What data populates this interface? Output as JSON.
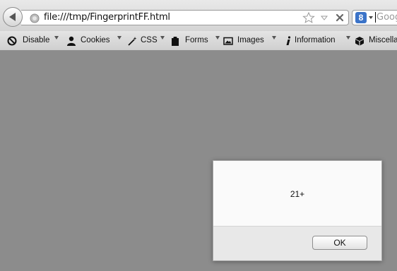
{
  "browser": {
    "url": "file:///tmp/FingerprintFF.html",
    "search_placeholder": "Goog",
    "search_engine_glyph": "8"
  },
  "toolbar": {
    "items": [
      {
        "label": "Disable",
        "icon": "no-entry-icon"
      },
      {
        "label": "Cookies",
        "icon": "person-icon"
      },
      {
        "label": "CSS",
        "icon": "magic-wand-icon"
      },
      {
        "label": "Forms",
        "icon": "clipboard-icon"
      },
      {
        "label": "Images",
        "icon": "image-icon"
      },
      {
        "label": "Information",
        "icon": "info-icon"
      },
      {
        "label": "Miscella",
        "icon": "box-icon"
      }
    ]
  },
  "dialog": {
    "message": "21+",
    "ok_label": "OK"
  },
  "colors": {
    "page_background": "#8c8c8c",
    "dialog_background": "#fafafa",
    "dialog_footer": "#e8e8e8"
  }
}
